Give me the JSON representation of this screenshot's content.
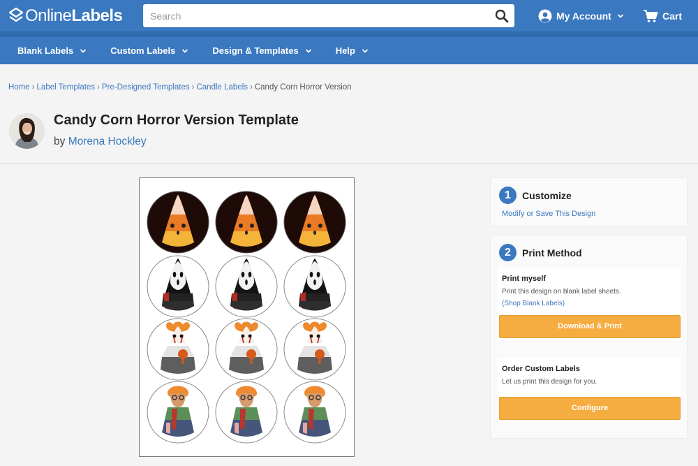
{
  "header": {
    "logo_light": "Online",
    "logo_bold": "Labels",
    "search_placeholder": "Search",
    "account_label": "My Account",
    "cart_label": "Cart"
  },
  "nav": {
    "items": [
      {
        "label": "Blank Labels"
      },
      {
        "label": "Custom Labels"
      },
      {
        "label": "Design & Templates"
      },
      {
        "label": "Help"
      }
    ]
  },
  "breadcrumb": {
    "items": [
      "Home",
      "Label Templates",
      "Pre-Designed Templates",
      "Candle Labels"
    ],
    "current": "Candy Corn Horror Version",
    "separator": "›"
  },
  "page": {
    "title": "Candy Corn Horror Version Template",
    "by": "by",
    "author": "Morena Hockley"
  },
  "sidebar": {
    "step1": {
      "number": "1",
      "title": "Customize",
      "link": "Modify or Save This Design"
    },
    "step2": {
      "number": "2",
      "title": "Print Method"
    },
    "print_myself": {
      "title": "Print myself",
      "text": "Print this design on blank label sheets.",
      "link": "(Shop Blank Labels)",
      "button": "Download & Print"
    },
    "order_custom": {
      "title": "Order Custom Labels",
      "text": "Let us print this design for you.",
      "button": "Configure"
    }
  },
  "sheet": {
    "rows": [
      "classic",
      "ghostface",
      "clown",
      "killer"
    ]
  },
  "colors": {
    "brand_blue": "#3a78c0",
    "button_orange": "#f5ac40"
  }
}
